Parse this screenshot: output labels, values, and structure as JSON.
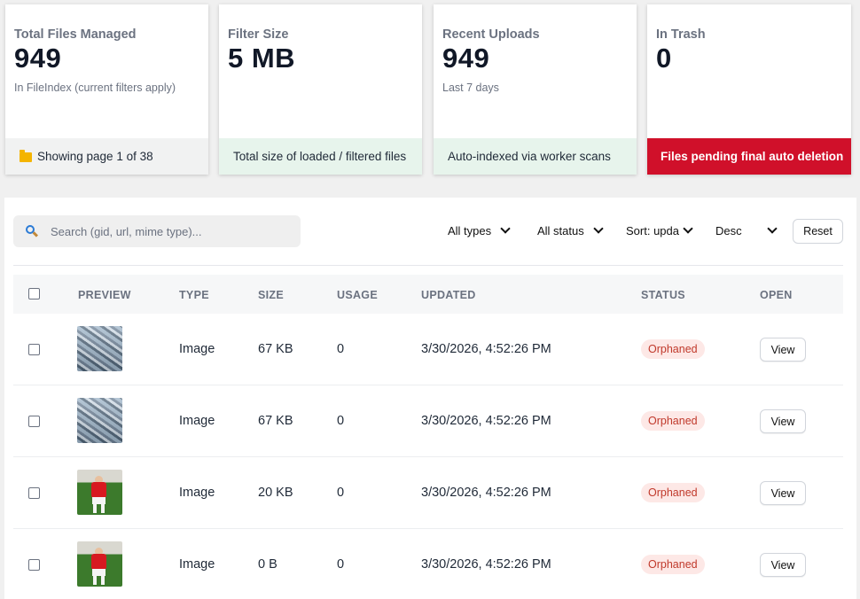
{
  "cards": [
    {
      "label": "Total Files Managed",
      "value": "949",
      "sub": "In FileIndex (current filters apply)",
      "footer": "Showing page 1 of 38",
      "footer_icon": "folder-icon"
    },
    {
      "label": "Filter Size",
      "value": "5 MB",
      "sub": "",
      "footer": "Total size of loaded / filtered files"
    },
    {
      "label": "Recent Uploads",
      "value": "949",
      "sub": "Last 7 days",
      "footer": "Auto-indexed via worker scans"
    },
    {
      "label": "In Trash",
      "value": "0",
      "sub": "",
      "footer": "Files pending final auto deletion"
    }
  ],
  "toolbar": {
    "search_placeholder": "Search (gid, url, mime type)...",
    "type_filter": "All types",
    "status_filter": "All status",
    "sort_filter": "Sort: updа",
    "order_filter": "Desc",
    "reset_label": "Reset"
  },
  "table": {
    "columns": [
      "PREVIEW",
      "TYPE",
      "SIZE",
      "USAGE",
      "UPDATED",
      "STATUS",
      "OPEN"
    ],
    "rows": [
      {
        "preview": "boxes",
        "type": "Image",
        "size": "67 KB",
        "usage": "0",
        "updated": "3/30/2026, 4:52:26 PM",
        "status": "Orphaned",
        "open": "View"
      },
      {
        "preview": "boxes",
        "type": "Image",
        "size": "67 KB",
        "usage": "0",
        "updated": "3/30/2026, 4:52:26 PM",
        "status": "Orphaned",
        "open": "View"
      },
      {
        "preview": "player",
        "type": "Image",
        "size": "20 KB",
        "usage": "0",
        "updated": "3/30/2026, 4:52:26 PM",
        "status": "Orphaned",
        "open": "View"
      },
      {
        "preview": "player",
        "type": "Image",
        "size": "0 B",
        "usage": "0",
        "updated": "3/30/2026, 4:52:26 PM",
        "status": "Orphaned",
        "open": "View"
      }
    ]
  },
  "colors": {
    "danger": "#d0102a",
    "success_bg": "#e7f4ec",
    "badge_bg": "#fde8e6",
    "badge_text": "#c0392b"
  }
}
